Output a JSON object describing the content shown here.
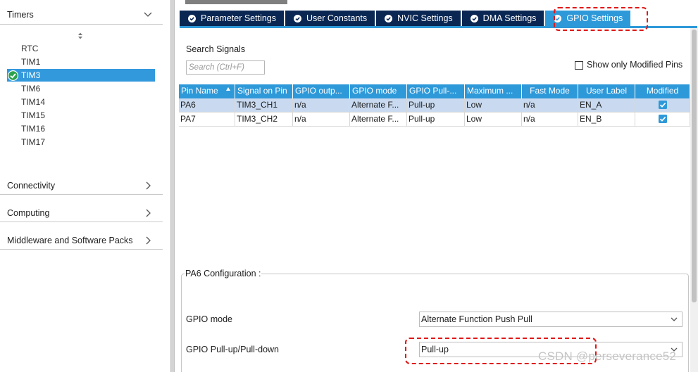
{
  "sidebar": {
    "timers_label": "Timers",
    "timers": [
      "RTC",
      "TIM1",
      "TIM3",
      "TIM6",
      "TIM14",
      "TIM15",
      "TIM16",
      "TIM17"
    ],
    "selected_timer": "TIM3",
    "categories": [
      "Connectivity",
      "Computing",
      "Middleware and Software Packs"
    ]
  },
  "tabs": [
    {
      "label": "Parameter Settings",
      "active": false
    },
    {
      "label": "User Constants",
      "active": false
    },
    {
      "label": "NVIC Settings",
      "active": false
    },
    {
      "label": "DMA Settings",
      "active": false
    },
    {
      "label": "GPIO Settings",
      "active": true
    }
  ],
  "search": {
    "label": "Search Signals",
    "placeholder": "Search (Ctrl+F)",
    "show_modified_label": "Show only Modified Pins"
  },
  "table": {
    "columns": [
      "Pin Name",
      "Signal on Pin",
      "GPIO outp...",
      "GPIO mode",
      "GPIO Pull-...",
      "Maximum ...",
      "Fast Mode",
      "User Label",
      "Modified"
    ],
    "rows": [
      [
        "PA6",
        "TIM3_CH1",
        "n/a",
        "Alternate F...",
        "Pull-up",
        "Low",
        "n/a",
        "EN_A",
        "checked"
      ],
      [
        "PA7",
        "TIM3_CH2",
        "n/a",
        "Alternate F...",
        "Pull-up",
        "Low",
        "n/a",
        "EN_B",
        "checked"
      ]
    ]
  },
  "config": {
    "title": "PA6 Configuration :",
    "gpio_mode_label": "GPIO mode",
    "gpio_mode_value": "Alternate Function Push Pull",
    "pull_label": "GPIO Pull-up/Pull-down",
    "pull_value": "Pull-up"
  },
  "watermark": "CSDN @perseverance52",
  "colors": {
    "accent": "#2e99d9",
    "tab_dark": "#0a2753",
    "selection": "#3399dd",
    "highlight": "#e01818"
  }
}
